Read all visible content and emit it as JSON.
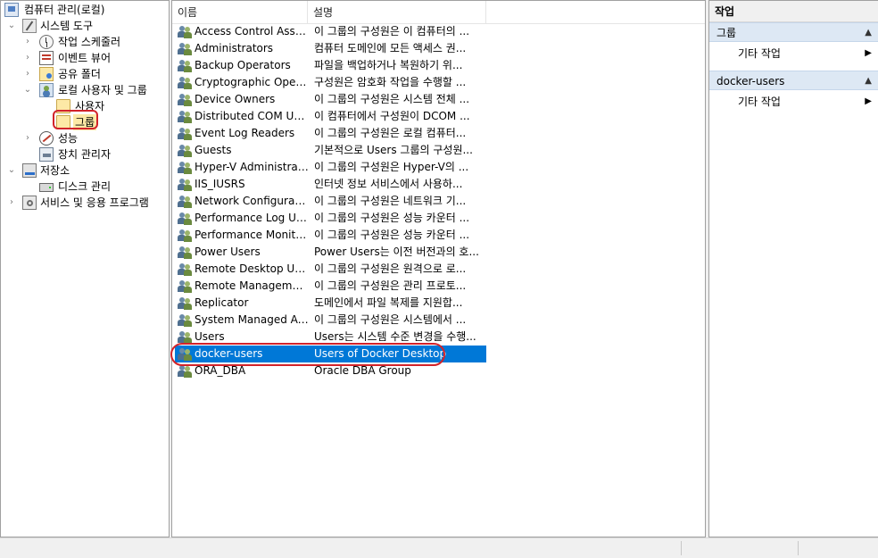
{
  "tree": {
    "root": "컴퓨터 관리(로컬)",
    "system_tools": "시스템 도구",
    "task_scheduler": "작업 스케줄러",
    "event_viewer": "이벤트 뷰어",
    "shared_folders": "공유 폴더",
    "local_users_groups": "로컬 사용자 및 그룹",
    "users": "사용자",
    "groups": "그룹",
    "performance": "성능",
    "device_manager": "장치 관리자",
    "storage": "저장소",
    "disk_management": "디스크 관리",
    "services_apps": "서비스 및 응용 프로그램",
    "expander_collapsed": "›",
    "expander_expanded": "⌄"
  },
  "list": {
    "col_name": "이름",
    "col_desc": "설명",
    "rows": [
      {
        "name": "Access Control Assist...",
        "desc": "이 그룹의 구성원은 이 컴퓨터의 ..."
      },
      {
        "name": "Administrators",
        "desc": "컴퓨터 도메인에 모든 액세스 권..."
      },
      {
        "name": "Backup Operators",
        "desc": "파일을 백업하거나 복원하기 위..."
      },
      {
        "name": "Cryptographic Operat...",
        "desc": "구성원은 암호화 작업을 수행할 ..."
      },
      {
        "name": "Device Owners",
        "desc": "이 그룹의 구성원은 시스템 전체 ..."
      },
      {
        "name": "Distributed COM Users",
        "desc": "이 컴퓨터에서 구성원이 DCOM ..."
      },
      {
        "name": "Event Log Readers",
        "desc": "이 그룹의 구성원은 로컬 컴퓨터..."
      },
      {
        "name": "Guests",
        "desc": "기본적으로 Users 그룹의 구성원..."
      },
      {
        "name": "Hyper-V Administrat...",
        "desc": "이 그룹의 구성원은 Hyper-V의 ..."
      },
      {
        "name": "IIS_IUSRS",
        "desc": "인터넷 정보 서비스에서 사용하..."
      },
      {
        "name": "Network Configuratio...",
        "desc": "이 그룹의 구성원은 네트워크 기..."
      },
      {
        "name": "Performance Log Users",
        "desc": "이 그룹의 구성원은 성능 카운터 ..."
      },
      {
        "name": "Performance Monitor...",
        "desc": "이 그룹의 구성원은 성능 카운터 ..."
      },
      {
        "name": "Power Users",
        "desc": "Power Users는 이전 버전과의 호..."
      },
      {
        "name": "Remote Desktop Users",
        "desc": "이 그룹의 구성원은 원격으로 로..."
      },
      {
        "name": "Remote Management...",
        "desc": "이 그룹의 구성원은 관리 프로토..."
      },
      {
        "name": "Replicator",
        "desc": "도메인에서 파일 복제를 지원합..."
      },
      {
        "name": "System Managed Acc...",
        "desc": "이 그룹의 구성원은 시스템에서 ..."
      },
      {
        "name": "Users",
        "desc": "Users는 시스템 수준 변경을 수행..."
      },
      {
        "name": "docker-users",
        "desc": "Users of Docker Desktop"
      },
      {
        "name": "ORA_DBA",
        "desc": "Oracle DBA Group"
      }
    ]
  },
  "actions": {
    "title": "작업",
    "section1": "그룹",
    "section1_item": "기타 작업",
    "section2": "docker-users",
    "section2_item": "기타 작업",
    "collapse_glyph": "▲",
    "more_glyph": "▶"
  },
  "colors": {
    "selection": "#0078d7",
    "highlight_ring": "#d2232a",
    "action_section_bg": "#dde8f4"
  }
}
